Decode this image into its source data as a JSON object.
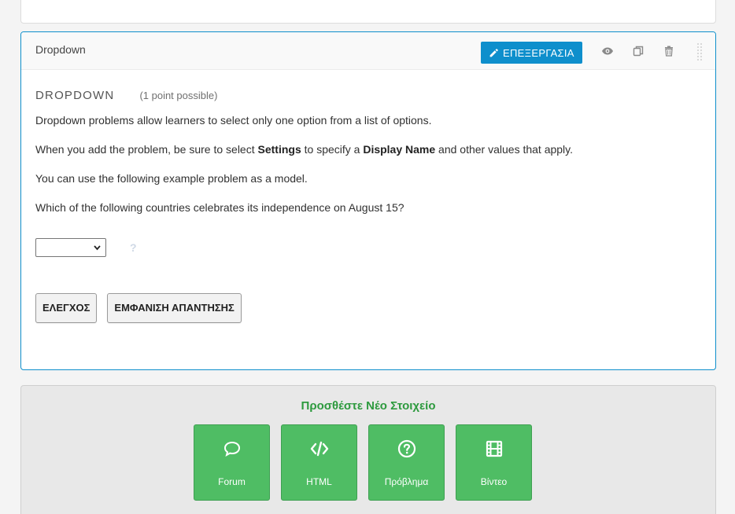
{
  "component": {
    "header_title": "Dropdown",
    "edit_label": "ΕΠΕΞΕΡΓΑΣΙΑ",
    "icons": [
      "eye-icon",
      "duplicate-icon",
      "delete-icon",
      "drag-handle-icon"
    ]
  },
  "problem": {
    "title": "DROPDOWN",
    "points": "(1 point possible)",
    "para1": "Dropdown problems allow learners to select only one option from a list of options.",
    "para2": {
      "pre": "When you add the problem, be sure to select ",
      "bold1": "Settings",
      "mid": " to specify a ",
      "bold2": "Display Name",
      "post": " and other values that apply."
    },
    "para3": "You can use the following example problem as a model.",
    "question": "Which of the following countries celebrates its independence on August 15?",
    "select_value": "",
    "help_mark": "?",
    "check_label": "ΕΛΕΓΧΟΣ",
    "show_answer_label": "ΕΜΦΑΝΙΣΗ ΑΠΑΝΤΗΣΗΣ"
  },
  "add_new": {
    "title": "Προσθέστε Νέο Στοιχείο",
    "tiles": [
      {
        "label": "Forum",
        "icon": "chat-bubble-icon"
      },
      {
        "label": "HTML",
        "icon": "code-icon"
      },
      {
        "label": "Πρόβλημα",
        "icon": "question-circle-icon"
      },
      {
        "label": "Βίντεο",
        "icon": "film-icon"
      }
    ]
  },
  "colors": {
    "accent_blue": "#0e8fcc",
    "tile_green": "#4fbd64",
    "title_green": "#2d9a3e"
  }
}
